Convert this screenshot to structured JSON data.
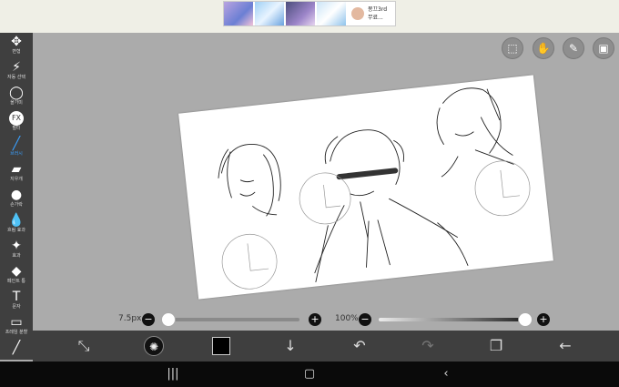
{
  "ad": {
    "title": "몽끄3rd",
    "subtitle": "무료..."
  },
  "sidebar": {
    "tools": [
      {
        "label": "변형",
        "icon": "move-icon",
        "glyph": "✥"
      },
      {
        "label": "자동 선택",
        "icon": "magic-wand-icon",
        "glyph": "⚡"
      },
      {
        "label": "올가미",
        "icon": "lasso-icon",
        "glyph": "◯"
      },
      {
        "label": "필터",
        "icon": "fx-icon",
        "glyph": "FX"
      },
      {
        "label": "브러시",
        "icon": "brush-icon",
        "glyph": "╱"
      },
      {
        "label": "지우개",
        "icon": "eraser-icon",
        "glyph": "▰"
      },
      {
        "label": "손가락",
        "icon": "smudge-icon",
        "glyph": "●"
      },
      {
        "label": "흐림 효과",
        "icon": "blur-icon",
        "glyph": "💧"
      },
      {
        "label": "효과",
        "icon": "effect-wand-icon",
        "glyph": "✦"
      },
      {
        "label": "페인트 통",
        "icon": "bucket-icon",
        "glyph": "◆"
      },
      {
        "label": "문자",
        "icon": "text-icon",
        "glyph": "T"
      },
      {
        "label": "프레임 분할",
        "icon": "frame-divider-icon",
        "glyph": "▭"
      },
      {
        "label": "",
        "icon": "eyedropper-icon",
        "glyph": "╱"
      }
    ],
    "active_index": 4
  },
  "brush_size": {
    "label": "7.5px",
    "minus": "−",
    "plus": "+",
    "value_fraction": 0.0
  },
  "opacity": {
    "label": "100%",
    "minus": "−",
    "plus": "+",
    "value_fraction": 1.0
  },
  "colors": {
    "accent": "#3aa0ff",
    "current_color": "#000000"
  }
}
